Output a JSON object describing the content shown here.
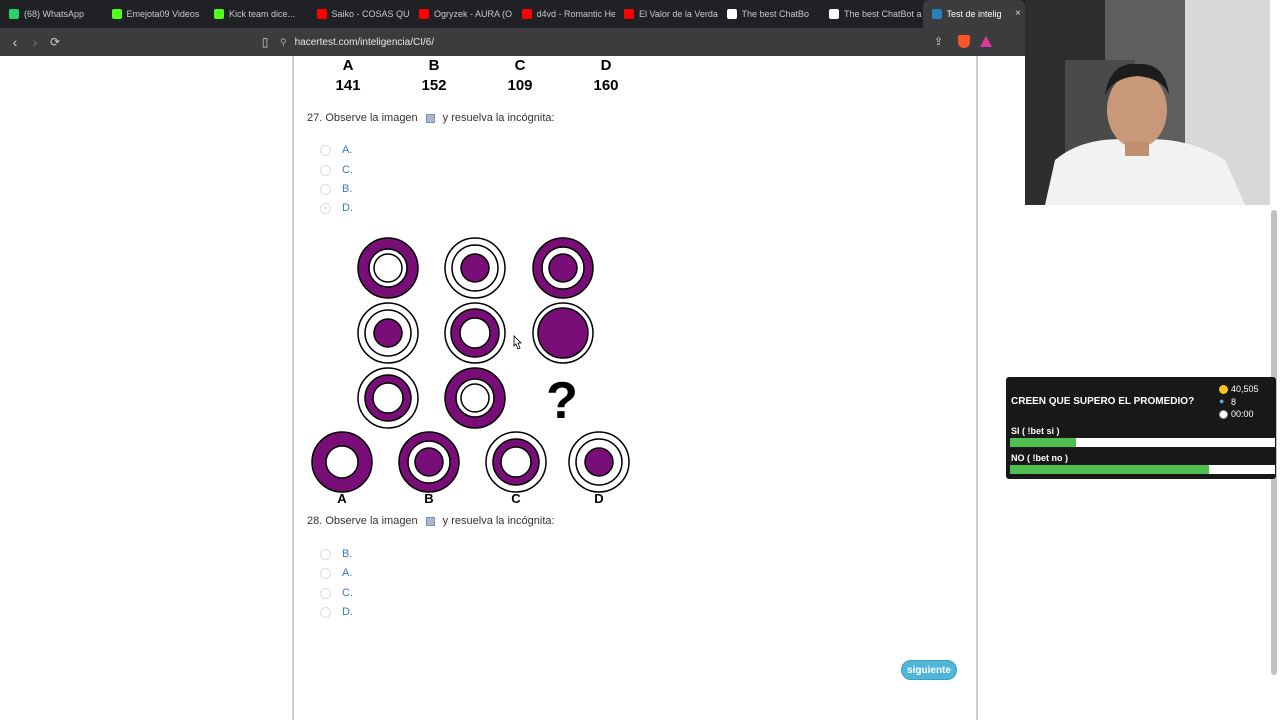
{
  "browser": {
    "tabs": [
      {
        "title": "(68) WhatsApp",
        "icon": "whatsapp-icon",
        "color": "#25d366"
      },
      {
        "title": "Emejota09 Videos",
        "icon": "kick-icon",
        "color": "#53fc18"
      },
      {
        "title": "Kick team dice...",
        "icon": "kick-icon",
        "color": "#53fc18"
      },
      {
        "title": "Saiko - COSAS QUE",
        "icon": "youtube-icon",
        "color": "#ff0000"
      },
      {
        "title": "Ogryzek - AURA (O",
        "icon": "youtube-icon",
        "color": "#ff0000"
      },
      {
        "title": "d4vd - Romantic He",
        "icon": "youtube-icon",
        "color": "#ff0000"
      },
      {
        "title": "El Valor de la Verda",
        "icon": "youtube-icon",
        "color": "#ff0000"
      },
      {
        "title": "The best ChatBo",
        "icon": "chatbot-icon",
        "color": "#ffffff"
      },
      {
        "title": "The best ChatBot a",
        "icon": "chatbot-icon",
        "color": "#ffffff"
      },
      {
        "title": "Test de intelig",
        "icon": "hacertest-icon",
        "color": "#2a7fc0"
      }
    ],
    "url": "hacertest.com/inteligencia/CI/6/"
  },
  "prev_answers": {
    "letters": [
      "A",
      "B",
      "C",
      "D"
    ],
    "values": [
      "141",
      "152",
      "109",
      "160"
    ]
  },
  "q27": {
    "before": "27. Observe la imagen",
    "after": "y resuelva la incógnita:",
    "options": [
      "A.",
      "C.",
      "B.",
      "D."
    ]
  },
  "puzzle": {
    "question_mark": "?",
    "answer_labels": [
      "A",
      "B",
      "C",
      "D"
    ],
    "fill_color": "#7a0e78"
  },
  "q28": {
    "before": "28. Observe la imagen",
    "after": "y resuelva la incógnita:",
    "options": [
      "B.",
      "A.",
      "C.",
      "D."
    ]
  },
  "next_button": "siguiente",
  "poll": {
    "question": "CREEN QUE SUPERO EL PROMEDIO?",
    "coins": "40,505",
    "voters": "8",
    "time": "00:00",
    "options": [
      {
        "label": "SI ( !bet si )",
        "fraction": 0.25
      },
      {
        "label": "NO ( !bet no )",
        "fraction": 0.75
      }
    ]
  }
}
